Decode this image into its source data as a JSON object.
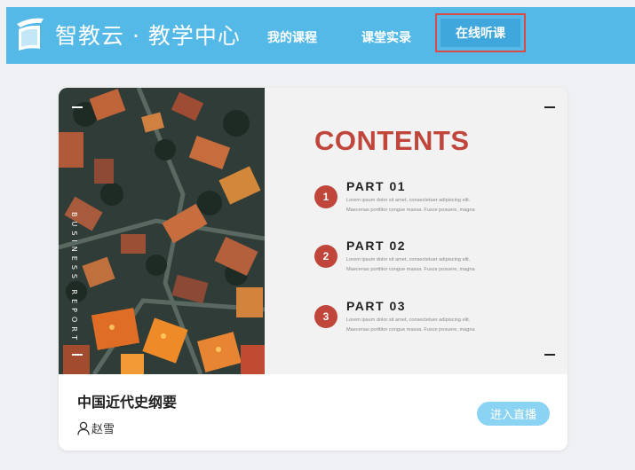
{
  "header": {
    "brand": "智教云 · 教学中心",
    "logo_icon": "open-book-icon",
    "nav": [
      {
        "label": "我的课程"
      },
      {
        "label": "课堂实录"
      },
      {
        "label": "在线听课",
        "active": true
      }
    ],
    "colors": {
      "bar": "#55b9e8",
      "active_bg": "#3fa7dc",
      "active_outline": "#d94b47"
    }
  },
  "course_card": {
    "slide": {
      "vertical_text": "BUSINESS REPORT",
      "heading": "CONTENTS",
      "parts": [
        {
          "number": "1",
          "title": "PART 01",
          "line1": "Lorem ipsum dolor sit amet, consectetuer adipiscing elit.",
          "line2": "Maecenas porttitor congue massa. Fusce posuere, magna"
        },
        {
          "number": "2",
          "title": "PART 02",
          "line1": "Lorem ipsum dolor sit amet, consectetuer adipiscing elit.",
          "line2": "Maecenas porttitor congue massa. Fusce posuere, magna"
        },
        {
          "number": "3",
          "title": "PART 03",
          "line1": "Lorem ipsum dolor sit amet, consectetuer adipiscing elit.",
          "line2": "Maecenas porttitor congue massa. Fusce posuere, magna"
        }
      ],
      "accent_color": "#c0453a"
    },
    "title": "中国近代史纲要",
    "teacher_icon": "user-icon",
    "teacher": "赵雪",
    "enter_button": "进入直播",
    "button_color": "#8ad3f3"
  }
}
